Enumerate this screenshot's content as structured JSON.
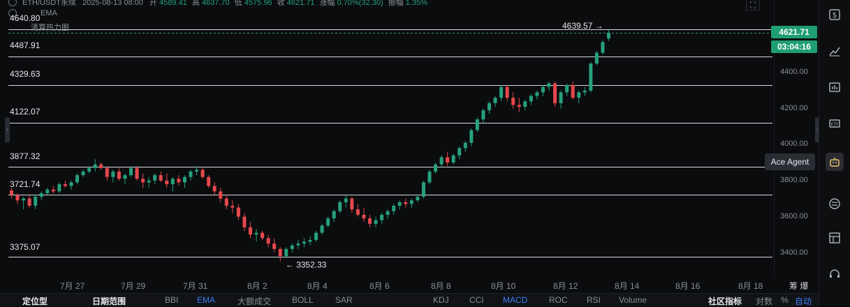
{
  "header": {
    "symbol": "ETH/USDT永续",
    "datetime": "2025-08-13 08:00",
    "open_label": "开",
    "open": "4589.41",
    "high_label": "高",
    "high": "4637.70",
    "low_label": "低",
    "low": "4575.96",
    "close_label": "收",
    "close": "4621.71",
    "change_label": "涨幅",
    "change": "0.70%(32.30)",
    "amplitude_label": "振幅",
    "amplitude": "1.35%",
    "ema_label": "EMA",
    "heatmap_label": "清算热力图"
  },
  "levels": [
    "4640.80",
    "4487.91",
    "4329.63",
    "4122.07",
    "3877.32",
    "3721.74",
    "3375.07"
  ],
  "annotations": {
    "high": "4639.57",
    "low": "3352.33"
  },
  "price_axis": {
    "ticks": [
      "4400.00",
      "4200.00",
      "4000.00",
      "3800.00",
      "3600.00",
      "3400.00"
    ],
    "last_price": "4621.71",
    "countdown": "03:04:16"
  },
  "date_axis": {
    "ticks": [
      "7月 27",
      "7月 29",
      "7月 31",
      "8月 2",
      "8月 4",
      "8月 6",
      "8月 8",
      "8月 10",
      "8月 12",
      "8月 14",
      "8月 16",
      "8月 18"
    ],
    "right_label": "筹  爆"
  },
  "right_rail": {
    "tooltip": "Ace Agent",
    "icons": [
      "dollar-icon",
      "trend-icon",
      "chart-icon",
      "etf-icon",
      "robot-icon",
      "exchange-icon",
      "layout-icon",
      "support-icon"
    ]
  },
  "bottom_bar": {
    "items": [
      "定位型",
      "日期范围",
      "BBI",
      "EMA",
      "大额成交",
      "BOLL",
      "SAR",
      "KDJ",
      "CCI",
      "MACD",
      "ROC",
      "RSI",
      "Volume",
      "社区指标",
      "对数",
      "%",
      "自动"
    ]
  },
  "chart_data": {
    "type": "candlestick",
    "ylim": [
      3300,
      4700
    ],
    "start_index_date": "2025-07-26",
    "candles": [
      [
        3745,
        3760,
        3700,
        3720
      ],
      [
        3720,
        3730,
        3670,
        3690
      ],
      [
        3690,
        3710,
        3640,
        3700
      ],
      [
        3700,
        3720,
        3650,
        3660
      ],
      [
        3660,
        3720,
        3640,
        3710
      ],
      [
        3710,
        3740,
        3690,
        3730
      ],
      [
        3730,
        3760,
        3720,
        3750
      ],
      [
        3750,
        3770,
        3730,
        3740
      ],
      [
        3740,
        3790,
        3730,
        3780
      ],
      [
        3780,
        3800,
        3760,
        3770
      ],
      [
        3770,
        3800,
        3750,
        3790
      ],
      [
        3790,
        3840,
        3780,
        3830
      ],
      [
        3830,
        3860,
        3820,
        3850
      ],
      [
        3850,
        3880,
        3840,
        3870
      ],
      [
        3870,
        3920,
        3850,
        3890
      ],
      [
        3890,
        3900,
        3860,
        3870
      ],
      [
        3870,
        3880,
        3800,
        3820
      ],
      [
        3820,
        3860,
        3790,
        3850
      ],
      [
        3850,
        3870,
        3800,
        3810
      ],
      [
        3810,
        3840,
        3780,
        3830
      ],
      [
        3830,
        3880,
        3820,
        3870
      ],
      [
        3870,
        3880,
        3800,
        3810
      ],
      [
        3810,
        3840,
        3760,
        3790
      ],
      [
        3790,
        3820,
        3760,
        3800
      ],
      [
        3800,
        3840,
        3780,
        3830
      ],
      [
        3830,
        3850,
        3790,
        3800
      ],
      [
        3800,
        3840,
        3760,
        3780
      ],
      [
        3780,
        3820,
        3740,
        3810
      ],
      [
        3810,
        3830,
        3770,
        3790
      ],
      [
        3790,
        3830,
        3760,
        3820
      ],
      [
        3820,
        3860,
        3800,
        3850
      ],
      [
        3850,
        3880,
        3830,
        3860
      ],
      [
        3860,
        3870,
        3810,
        3820
      ],
      [
        3820,
        3830,
        3760,
        3770
      ],
      [
        3770,
        3790,
        3720,
        3740
      ],
      [
        3740,
        3760,
        3680,
        3700
      ],
      [
        3700,
        3720,
        3640,
        3660
      ],
      [
        3660,
        3690,
        3620,
        3650
      ],
      [
        3650,
        3670,
        3580,
        3600
      ],
      [
        3600,
        3620,
        3520,
        3540
      ],
      [
        3540,
        3570,
        3480,
        3500
      ],
      [
        3500,
        3530,
        3460,
        3510
      ],
      [
        3510,
        3520,
        3470,
        3480
      ],
      [
        3480,
        3500,
        3430,
        3450
      ],
      [
        3450,
        3480,
        3400,
        3420
      ],
      [
        3420,
        3430,
        3352,
        3380
      ],
      [
        3380,
        3430,
        3370,
        3420
      ],
      [
        3420,
        3450,
        3400,
        3440
      ],
      [
        3440,
        3470,
        3420,
        3450
      ],
      [
        3450,
        3480,
        3430,
        3460
      ],
      [
        3460,
        3490,
        3440,
        3470
      ],
      [
        3470,
        3520,
        3460,
        3510
      ],
      [
        3510,
        3560,
        3500,
        3550
      ],
      [
        3550,
        3600,
        3540,
        3590
      ],
      [
        3590,
        3640,
        3570,
        3630
      ],
      [
        3630,
        3690,
        3620,
        3680
      ],
      [
        3680,
        3720,
        3650,
        3700
      ],
      [
        3700,
        3710,
        3620,
        3640
      ],
      [
        3640,
        3670,
        3600,
        3610
      ],
      [
        3610,
        3650,
        3570,
        3590
      ],
      [
        3590,
        3610,
        3540,
        3560
      ],
      [
        3560,
        3600,
        3540,
        3580
      ],
      [
        3580,
        3620,
        3560,
        3610
      ],
      [
        3610,
        3640,
        3590,
        3630
      ],
      [
        3630,
        3670,
        3610,
        3660
      ],
      [
        3660,
        3690,
        3640,
        3680
      ],
      [
        3680,
        3700,
        3650,
        3670
      ],
      [
        3670,
        3700,
        3650,
        3690
      ],
      [
        3690,
        3720,
        3680,
        3710
      ],
      [
        3710,
        3800,
        3700,
        3790
      ],
      [
        3790,
        3860,
        3780,
        3850
      ],
      [
        3850,
        3900,
        3840,
        3890
      ],
      [
        3890,
        3940,
        3870,
        3930
      ],
      [
        3930,
        3960,
        3880,
        3900
      ],
      [
        3900,
        3950,
        3890,
        3940
      ],
      [
        3940,
        3990,
        3920,
        3980
      ],
      [
        3980,
        4020,
        3960,
        4010
      ],
      [
        4010,
        4090,
        3990,
        4080
      ],
      [
        4080,
        4150,
        4070,
        4140
      ],
      [
        4140,
        4200,
        4120,
        4190
      ],
      [
        4190,
        4240,
        4170,
        4230
      ],
      [
        4230,
        4270,
        4210,
        4260
      ],
      [
        4260,
        4330,
        4240,
        4320
      ],
      [
        4320,
        4330,
        4240,
        4260
      ],
      [
        4260,
        4290,
        4200,
        4220
      ],
      [
        4220,
        4260,
        4180,
        4210
      ],
      [
        4210,
        4250,
        4190,
        4240
      ],
      [
        4240,
        4280,
        4220,
        4270
      ],
      [
        4270,
        4300,
        4250,
        4290
      ],
      [
        4290,
        4330,
        4270,
        4320
      ],
      [
        4320,
        4350,
        4300,
        4340
      ],
      [
        4340,
        4350,
        4210,
        4230
      ],
      [
        4230,
        4300,
        4200,
        4290
      ],
      [
        4290,
        4340,
        4270,
        4330
      ],
      [
        4330,
        4350,
        4250,
        4260
      ],
      [
        4260,
        4300,
        4230,
        4290
      ],
      [
        4290,
        4320,
        4270,
        4300
      ],
      [
        4300,
        4460,
        4290,
        4450
      ],
      [
        4450,
        4520,
        4440,
        4510
      ],
      [
        4510,
        4580,
        4500,
        4570
      ],
      [
        4589.41,
        4639.57,
        4575.96,
        4621.71
      ]
    ]
  }
}
